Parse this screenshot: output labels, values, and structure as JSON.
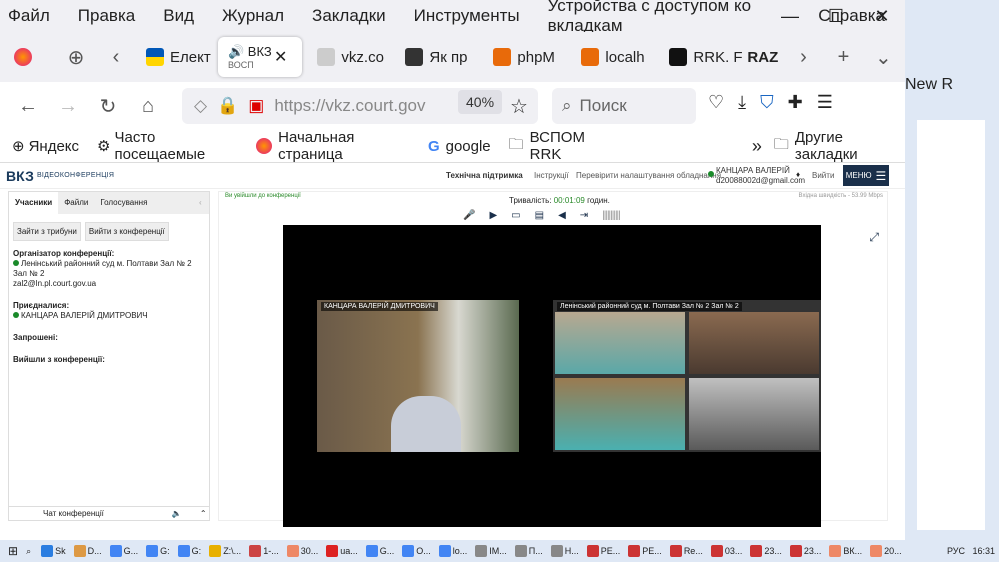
{
  "menu": [
    "Файл",
    "Правка",
    "Вид",
    "Журнал",
    "Закладки",
    "Инструменты",
    "Устройства с доступом ко вкладкам",
    "Справка"
  ],
  "tabs": [
    {
      "label": "Елект",
      "color": "#ffd500"
    },
    {
      "label": "ВКЗ",
      "sub": "ВОСП",
      "active": true
    },
    {
      "label": "vkz.co",
      "color": "#999"
    },
    {
      "label": "Як пр",
      "color": "#111"
    },
    {
      "label": "phpM",
      "color": "#e86a0a"
    },
    {
      "label": "localh",
      "color": "#e86a0a"
    },
    {
      "label": "RRK. F",
      "color": "#111"
    },
    {
      "label": "RAZ",
      "color": "#111"
    }
  ],
  "url": "https://vkz.court.gov",
  "zoom": "40%",
  "search_placeholder": "Поиск",
  "bookmarks": [
    {
      "label": "Яндекс",
      "icon": "globe-icon"
    },
    {
      "label": "Часто посещаемые",
      "icon": "gear-icon"
    },
    {
      "label": "Начальная страница",
      "icon": "firefox-icon"
    },
    {
      "label": "google",
      "icon": "google-icon"
    },
    {
      "label": "ВСПОМ RRK",
      "icon": "folder-icon"
    }
  ],
  "other_bookmarks": "Другие закладки",
  "vkz": {
    "logo": "ВКЗ",
    "logo_sub": "ВІДЕОКОНФЕРЕНЦІЯ",
    "support": "Технічна підтримка",
    "instructions": "Інструкції",
    "check_hw": "Перевірити налаштування обладнання",
    "user": "КАНЦАРА ВАЛЕРІЙ",
    "user_email": "d20088002d@gmail.com",
    "logout": "Вийти",
    "menu": "МЕНЮ",
    "joined_msg": "Ви увійшли до конференції",
    "duration_label": "Тривалість:",
    "duration": "00:01:09",
    "duration_unit": "годин.",
    "speed": "Вхідна швидкість - 53.99 Mbps",
    "tabs": [
      "Учасники",
      "Файли",
      "Голосування"
    ],
    "btn_tribune": "Зайти з трибуни",
    "btn_leave": "Вийти з конференції",
    "organizer_title": "Організатор конференції:",
    "organizer": "Ленінський районний суд м. Полтави Зал № 2 Зал № 2",
    "organizer_email": "zal2@ln.pl.court.gov.ua",
    "joined_title": "Приєдналися:",
    "joined_user": "КАНЦАРА ВАЛЕРІЙ ДМИТРОВИЧ",
    "invited_title": "Запрошені:",
    "left_title": "Вийшли з конференції:",
    "chat": "Чат конференції",
    "feed_left": "КАНЦАРА ВАЛЕРІЙ ДМИТРОВИЧ",
    "feed_right": "Ленінський районний суд м. Полтави Зал № 2 Зал № 2"
  },
  "right_app": {
    "text": "New R"
  },
  "taskbar": [
    "Sk",
    "D...",
    "G...",
    "G:",
    "G:",
    "Z:\\...",
    "1-...",
    "30...",
    "ua...",
    "G...",
    "O...",
    "lo...",
    "IM...",
    "П...",
    "Н...",
    "PE...",
    "PE...",
    "Re...",
    "03...",
    "23...",
    "23...",
    "ВК...",
    "20..."
  ],
  "clock": "16:31",
  "lang": "РУС"
}
